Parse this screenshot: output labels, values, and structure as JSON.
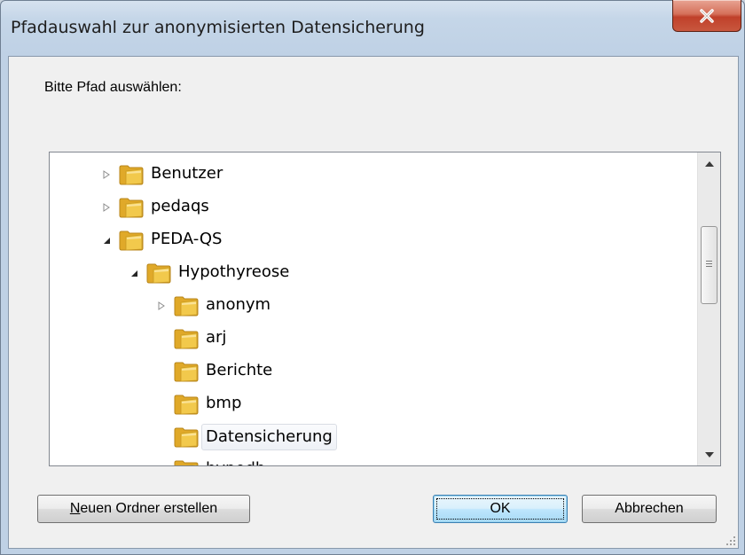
{
  "window": {
    "title": "Pfadauswahl zur anonymisierten Datensicherung"
  },
  "dialog": {
    "prompt": "Bitte Pfad auswählen:"
  },
  "tree": {
    "selected": "Datensicherung",
    "items": [
      {
        "label": "Benutzer",
        "level": 0,
        "expander": "collapsed"
      },
      {
        "label": "pedaqs",
        "level": 0,
        "expander": "collapsed"
      },
      {
        "label": "PEDA-QS",
        "level": 0,
        "expander": "expanded"
      },
      {
        "label": "Hypothyreose",
        "level": 1,
        "expander": "expanded"
      },
      {
        "label": "anonym",
        "level": 2,
        "expander": "collapsed"
      },
      {
        "label": "arj",
        "level": 2,
        "expander": "none"
      },
      {
        "label": "Berichte",
        "level": 2,
        "expander": "none"
      },
      {
        "label": "bmp",
        "level": 2,
        "expander": "none"
      },
      {
        "label": "Datensicherung",
        "level": 2,
        "expander": "none"
      },
      {
        "label": "hypodb",
        "level": 2,
        "expander": "none"
      }
    ]
  },
  "buttons": {
    "new_folder": "Neuen Ordner erstellen",
    "ok": "OK",
    "cancel": "Abbrechen"
  },
  "colors": {
    "folder": "#f2c94c",
    "close_button": "#c8553d",
    "default_button_border": "#3c7fb1"
  }
}
